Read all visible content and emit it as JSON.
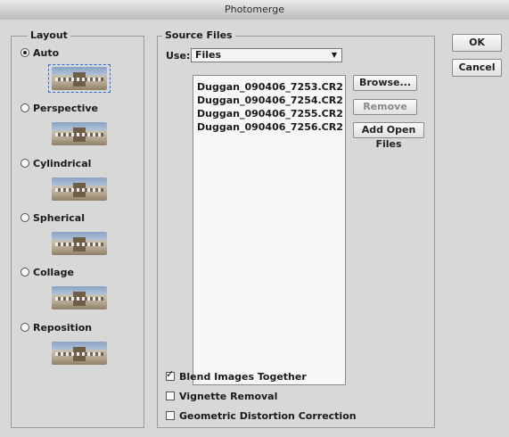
{
  "window": {
    "title": "Photomerge"
  },
  "layout": {
    "legend": "Layout",
    "options": [
      {
        "label": "Auto",
        "selected": true
      },
      {
        "label": "Perspective",
        "selected": false
      },
      {
        "label": "Cylindrical",
        "selected": false
      },
      {
        "label": "Spherical",
        "selected": false
      },
      {
        "label": "Collage",
        "selected": false
      },
      {
        "label": "Reposition",
        "selected": false
      }
    ]
  },
  "source": {
    "legend": "Source Files",
    "use_label": "Use:",
    "use_value": "Files",
    "files": [
      "Duggan_090406_7253.CR2",
      "Duggan_090406_7254.CR2",
      "Duggan_090406_7255.CR2",
      "Duggan_090406_7256.CR2"
    ],
    "browse_label": "Browse...",
    "remove_label": "Remove",
    "add_open_label": "Add Open Files",
    "checkboxes": [
      {
        "label": "Blend Images Together",
        "checked": true
      },
      {
        "label": "Vignette Removal",
        "checked": false
      },
      {
        "label": "Geometric Distortion Correction",
        "checked": false
      }
    ]
  },
  "buttons": {
    "ok": "OK",
    "cancel": "Cancel"
  }
}
